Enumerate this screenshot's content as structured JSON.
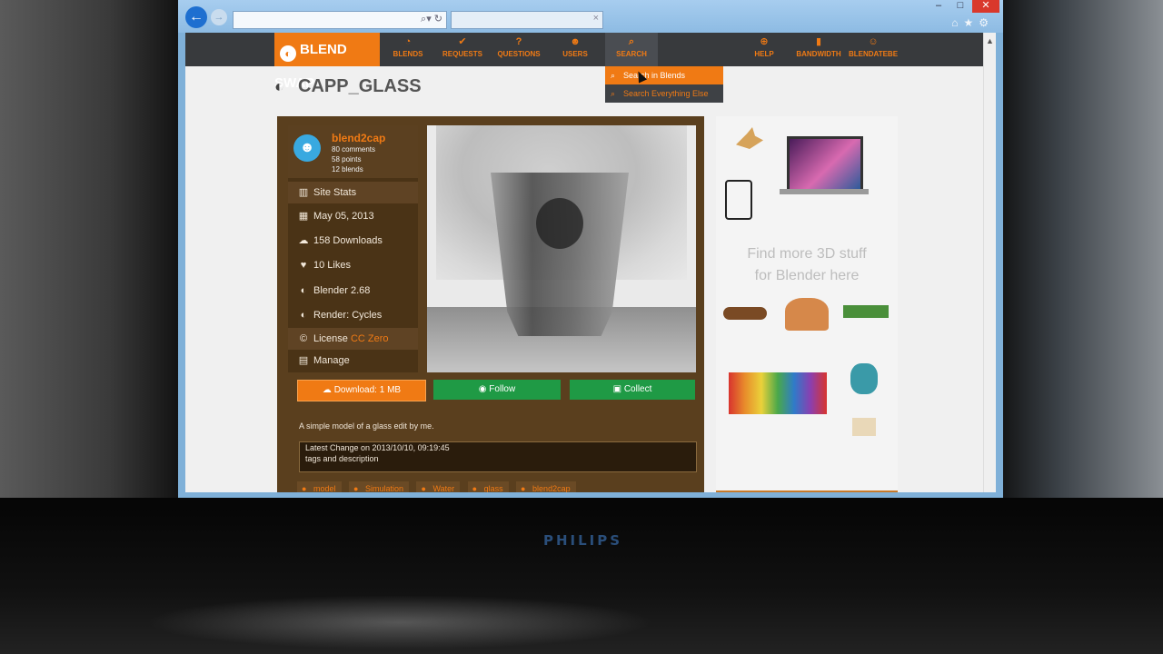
{
  "site": {
    "logo": "BLEND SWAP",
    "nav": [
      {
        "label": "BLENDS",
        "icon": "blender-icon"
      },
      {
        "label": "REQUESTS",
        "icon": "check-icon"
      },
      {
        "label": "QUESTIONS",
        "icon": "question-icon"
      },
      {
        "label": "USERS",
        "icon": "users-icon"
      },
      {
        "label": "SEARCH",
        "icon": "search-icon"
      },
      {
        "label": "HELP",
        "icon": "lifebuoy-icon"
      },
      {
        "label": "BANDWIDTH",
        "icon": "bars-icon"
      },
      {
        "label": "BLENDATEBE",
        "icon": "user-icon"
      }
    ],
    "search_dropdown": [
      "Search in Blends",
      "Search Everything Else"
    ]
  },
  "page": {
    "title": "CAPP_GLASS"
  },
  "user": {
    "name": "blend2cap",
    "comments": "80 comments",
    "points": "58 points",
    "blends": "12 blends"
  },
  "sidebar": {
    "site_stats": "Site Stats",
    "date": "May 05, 2013",
    "downloads": "158 Downloads",
    "likes": "10 Likes",
    "blender_version": "Blender 2.68",
    "render": "Render: Cycles",
    "license_label": "License",
    "license_value": "CC Zero",
    "manage": "Manage"
  },
  "actions": {
    "download": "Download: 1 MB",
    "follow": "Follow",
    "collect": "Collect"
  },
  "description": "A simple model of a glass edit by me.",
  "latest_change": {
    "line1": "Latest Change on 2013/10/10, 09:19:45",
    "line2": "tags and description"
  },
  "tags": [
    "model",
    "Simulation",
    "Water",
    "glass",
    "blend2cap"
  ],
  "ad": {
    "text_line1": "Find more 3D stuff",
    "text_line2": "for Blender here"
  },
  "monitor_brand": "PHILIPS",
  "colors": {
    "accent": "#f07a14",
    "panel": "#5a3f1e",
    "green": "#1f9a45",
    "navbar": "#383a3d"
  }
}
